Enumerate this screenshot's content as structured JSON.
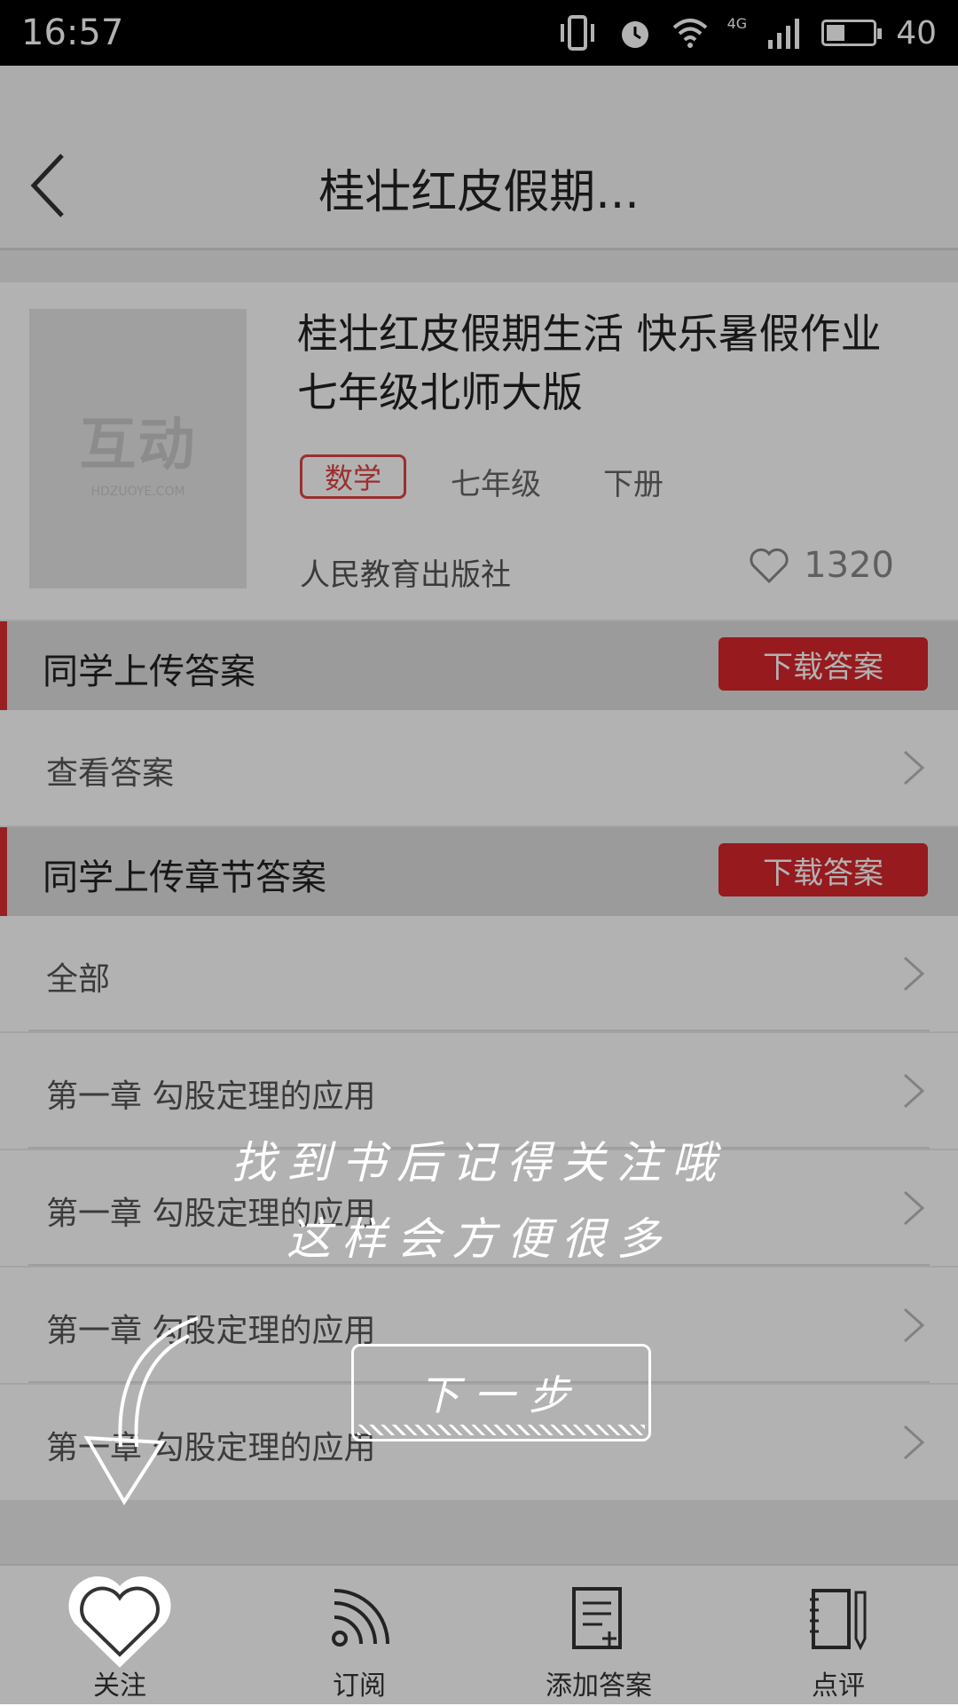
{
  "status_bar": {
    "time": "16:57",
    "network": "4G",
    "battery": "40",
    "battery_level": 0.4
  },
  "header": {
    "title": "桂壮红皮假期..."
  },
  "book": {
    "cover_logo": "互动",
    "cover_sub": "HDZUOYE.COM",
    "name": "桂壮红皮假期生活 快乐暑假作业七年级北师大版",
    "subject_tag": "数学",
    "grade": "七年级",
    "volume": "下册",
    "publisher": "人民教育出版社",
    "likes": "1320"
  },
  "sections": [
    {
      "title": "同学上传答案",
      "button": "下载答案"
    },
    {
      "title": "同学上传章节答案",
      "button": "下载答案"
    }
  ],
  "rows": {
    "view_answer": "查看答案",
    "all": "全部",
    "chapters": [
      "第一章  勾股定理的应用",
      "第一章  勾股定理的应用",
      "第一章  勾股定理的应用",
      "第一章  勾股定理的应用"
    ]
  },
  "tabs": [
    {
      "label": "关注",
      "icon": "heart-icon"
    },
    {
      "label": "订阅",
      "icon": "rss-icon"
    },
    {
      "label": "添加答案",
      "icon": "add-document-icon"
    },
    {
      "label": "点评",
      "icon": "notebook-pen-icon"
    }
  ],
  "guide": {
    "line1": "找到书后记得关注哦",
    "line2": "这样会方便很多",
    "next": "下一步"
  },
  "colors": {
    "accent": "#d7262b",
    "overlay": "rgba(0,0,0,0.30)"
  }
}
